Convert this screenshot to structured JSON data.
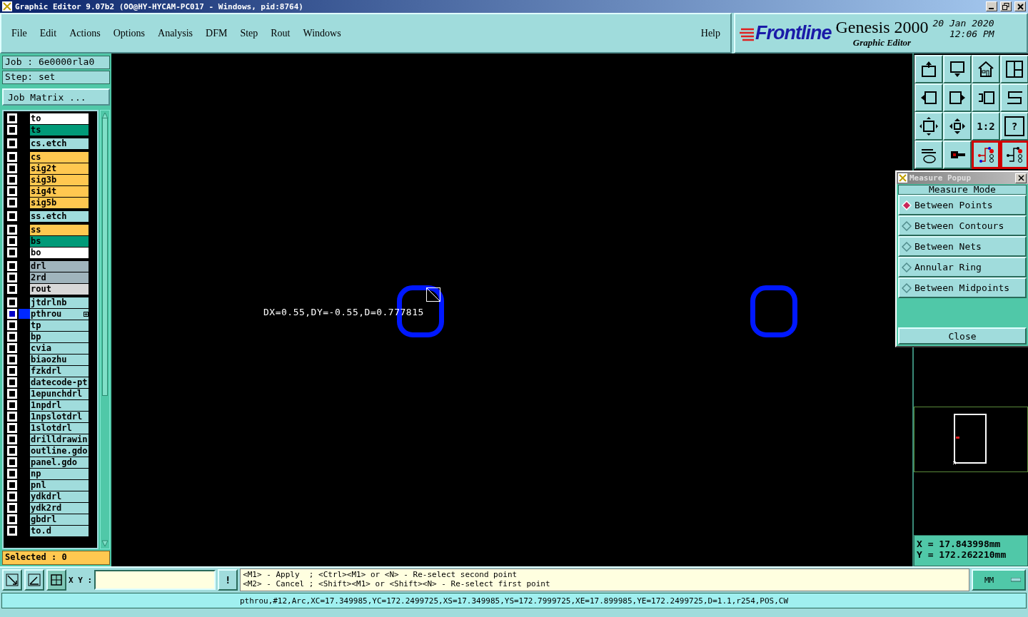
{
  "window": {
    "title": "Graphic Editor 9.07b2 (OO@HY-HYCAM-PC017 - Windows, pid:8764)"
  },
  "menu": [
    {
      "label": "File"
    },
    {
      "label": "Edit"
    },
    {
      "label": "Actions"
    },
    {
      "label": "Options"
    },
    {
      "label": "Analysis"
    },
    {
      "label": "DFM"
    },
    {
      "label": "Step"
    },
    {
      "label": "Rout"
    },
    {
      "label": "Windows"
    }
  ],
  "help_menu": {
    "label": "Help"
  },
  "brand": {
    "logo": "Frontline",
    "product": "Genesis 2000",
    "subtitle": "Graphic Editor",
    "date": "20 Jan 2020",
    "time": "12:06 PM"
  },
  "job": {
    "job": "Job  :  6e0000rla0",
    "step": "Step:  set",
    "matrix_button": "Job Matrix ..."
  },
  "layer_groups": [
    {
      "layers": [
        {
          "name": "to",
          "color": "#ffffff",
          "checked": false,
          "selected": false
        },
        {
          "name": "ts",
          "color": "#009a78",
          "checked": false,
          "selected": false
        }
      ]
    },
    {
      "layers": [
        {
          "name": "cs.etch",
          "color": "#a0dcdc",
          "checked": false,
          "selected": false
        }
      ]
    },
    {
      "layers": [
        {
          "name": "cs",
          "color": "#ffc850",
          "checked": false,
          "selected": false
        },
        {
          "name": "sig2t",
          "color": "#ffc850",
          "checked": false,
          "selected": false
        },
        {
          "name": "sig3b",
          "color": "#ffc850",
          "checked": false,
          "selected": false
        },
        {
          "name": "sig4t",
          "color": "#ffc850",
          "checked": false,
          "selected": false
        },
        {
          "name": "sig5b",
          "color": "#ffc850",
          "checked": false,
          "selected": false
        }
      ]
    },
    {
      "layers": [
        {
          "name": "ss.etch",
          "color": "#a0dcdc",
          "checked": false,
          "selected": false
        }
      ]
    },
    {
      "layers": [
        {
          "name": "ss",
          "color": "#ffc850",
          "checked": false,
          "selected": false
        },
        {
          "name": "bs",
          "color": "#009a78",
          "checked": false,
          "selected": false
        },
        {
          "name": "bo",
          "color": "#ffffff",
          "checked": false,
          "selected": false
        }
      ]
    },
    {
      "layers": [
        {
          "name": "drl",
          "color": "#a0b4bc",
          "checked": false,
          "selected": false
        },
        {
          "name": "2rd",
          "color": "#a0b4bc",
          "checked": false,
          "selected": false
        },
        {
          "name": "rout",
          "color": "#d8d8d8",
          "checked": false,
          "selected": false
        }
      ]
    },
    {
      "layers": [
        {
          "name": "jtdrlnb",
          "color": "#a0dcdc",
          "checked": false,
          "selected": false
        },
        {
          "name": "pthrou",
          "color": "#a0dcdc",
          "checked": false,
          "selected": true
        },
        {
          "name": "tp",
          "color": "#a0dcdc",
          "checked": false,
          "selected": false
        },
        {
          "name": "bp",
          "color": "#a0dcdc",
          "checked": false,
          "selected": false
        },
        {
          "name": "cvia",
          "color": "#a0dcdc",
          "checked": false,
          "selected": false
        },
        {
          "name": "biaozhu",
          "color": "#a0dcdc",
          "checked": false,
          "selected": false
        },
        {
          "name": "fzkdrl",
          "color": "#a0dcdc",
          "checked": false,
          "selected": false
        },
        {
          "name": "datecode-pt",
          "color": "#a0dcdc",
          "checked": false,
          "selected": false
        },
        {
          "name": "1epunchdrl",
          "color": "#a0dcdc",
          "checked": false,
          "selected": false
        },
        {
          "name": "1npdrl",
          "color": "#a0dcdc",
          "checked": false,
          "selected": false
        },
        {
          "name": "1npslotdrl",
          "color": "#a0dcdc",
          "checked": false,
          "selected": false
        },
        {
          "name": "1slotdrl",
          "color": "#a0dcdc",
          "checked": false,
          "selected": false
        },
        {
          "name": "drilldrawin",
          "color": "#a0dcdc",
          "checked": false,
          "selected": false
        },
        {
          "name": "outline.gdo",
          "color": "#a0dcdc",
          "checked": false,
          "selected": false
        },
        {
          "name": "panel.gdo",
          "color": "#a0dcdc",
          "checked": false,
          "selected": false
        },
        {
          "name": "np",
          "color": "#a0dcdc",
          "checked": false,
          "selected": false
        },
        {
          "name": "pnl",
          "color": "#a0dcdc",
          "checked": false,
          "selected": false
        },
        {
          "name": "ydkdrl",
          "color": "#a0dcdc",
          "checked": false,
          "selected": false
        },
        {
          "name": "ydk2rd",
          "color": "#a0dcdc",
          "checked": false,
          "selected": false
        },
        {
          "name": "gbdrl",
          "color": "#a0dcdc",
          "checked": false,
          "selected": false
        },
        {
          "name": "to.d",
          "color": "#a0dcdc",
          "checked": false,
          "selected": false
        }
      ]
    }
  ],
  "selected_count": "Selected : 0",
  "canvas": {
    "measure_text": "DX=0.55,DY=-0.55,D=0.777815"
  },
  "toolbar": {
    "ratio_label": "1:2",
    "help_label": "?"
  },
  "measure_popup": {
    "title": "Measure Popup",
    "heading": "Measure Mode",
    "modes": [
      {
        "label": "Between Points",
        "selected": true
      },
      {
        "label": "Between Contours",
        "selected": false
      },
      {
        "label": "Between Nets",
        "selected": false
      },
      {
        "label": "Annular Ring",
        "selected": false
      },
      {
        "label": "Between Midpoints",
        "selected": false
      }
    ],
    "close": "Close"
  },
  "coordinates": {
    "x": "X  =  17.843998mm",
    "y": "Y  =  172.262210mm"
  },
  "bottom_bar": {
    "xy_label": "X Y :",
    "alert": "!",
    "messages": [
      "<M1> - Apply  ; <Ctrl><M1> or <N> - Re-select second point",
      "<M2> - Cancel ; <Shift><M1> or <Shift><N> - Re-select first point"
    ],
    "units": "MM"
  },
  "status_bar": "pthrou,#12,Arc,XC=17.349985,YC=172.2499725,XS=17.349985,YS=172.7999725,XE=17.899985,YE=172.2499725,D=1.1,r254,POS,CW"
}
